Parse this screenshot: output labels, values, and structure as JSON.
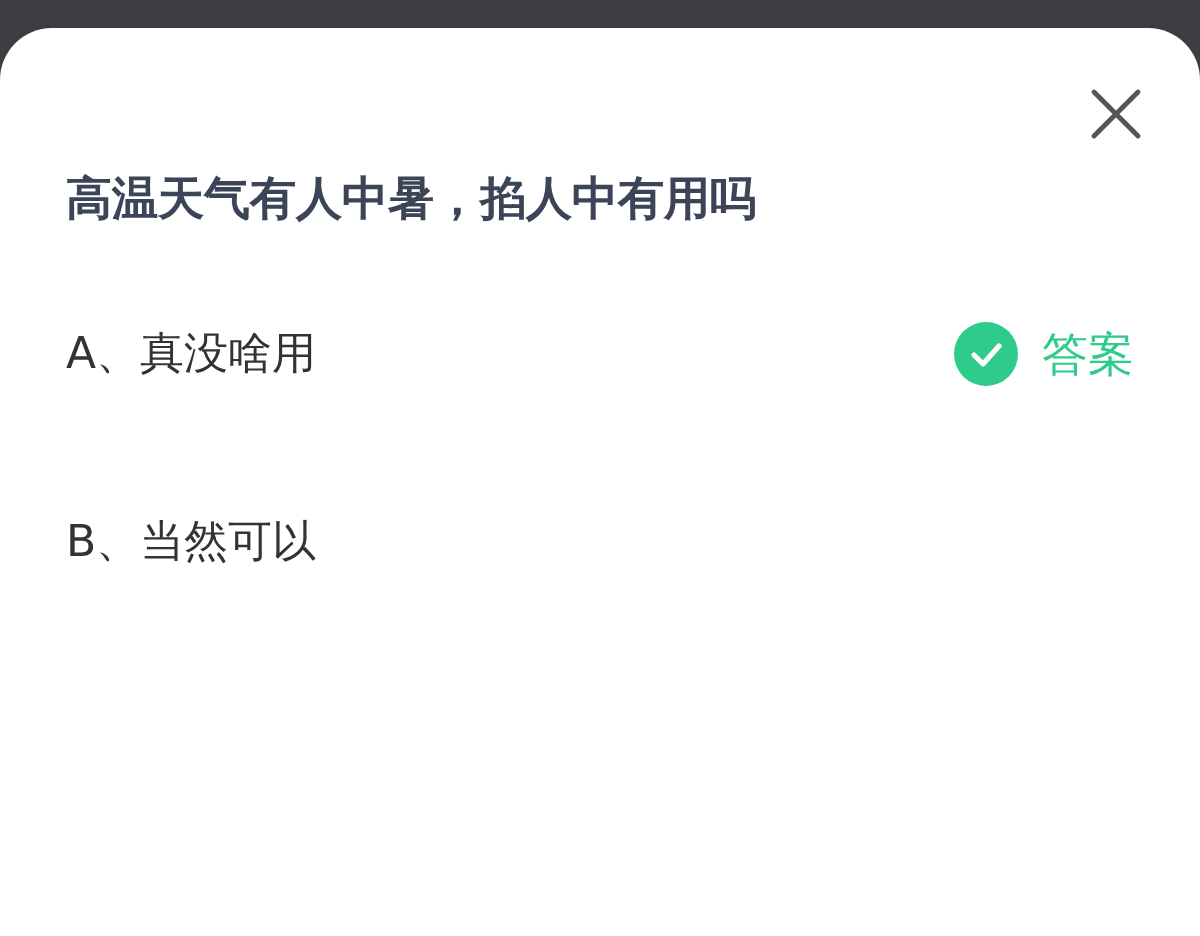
{
  "question": "高温天气有人中暑，掐人中有用吗",
  "options": [
    {
      "label": "A、真没啥用",
      "correct": true
    },
    {
      "label": "B、当然可以",
      "correct": false
    }
  ],
  "answer_label": "答案"
}
